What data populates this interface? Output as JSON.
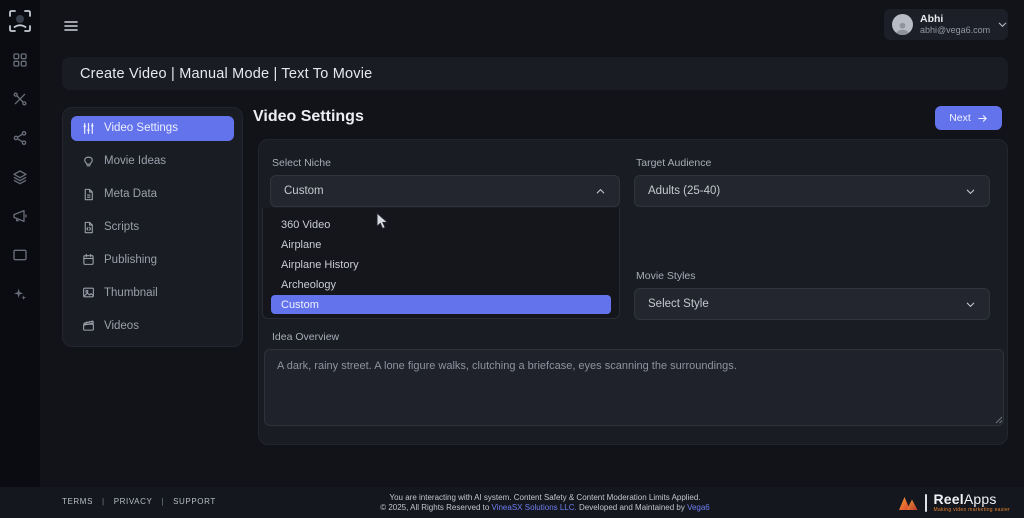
{
  "colors": {
    "accent": "#6373ec",
    "rail_bg": "#0a0c11",
    "page_bg": "#111319",
    "card_bg": "#191c23",
    "brand_orange": "#e8812b"
  },
  "topbar": {
    "user": {
      "name": "Abhi",
      "email": "abhi@vega6.com"
    }
  },
  "title_bar": {
    "text": "Create Video | Manual Mode | Text To Movie"
  },
  "sidebar": {
    "items": [
      {
        "label": "Video Settings",
        "icon": "sliders-icon",
        "active": true
      },
      {
        "label": "Movie Ideas",
        "icon": "lightbulb-icon",
        "active": false
      },
      {
        "label": "Meta Data",
        "icon": "file-icon",
        "active": false
      },
      {
        "label": "Scripts",
        "icon": "code-file-icon",
        "active": false
      },
      {
        "label": "Publishing",
        "icon": "calendar-icon",
        "active": false
      },
      {
        "label": "Thumbnail",
        "icon": "image-icon",
        "active": false
      },
      {
        "label": "Videos",
        "icon": "clapperboard-icon",
        "active": false
      }
    ]
  },
  "main": {
    "heading": "Video Settings",
    "next_label": "Next",
    "form": {
      "select_niche": {
        "label": "Select Niche",
        "value": "Custom",
        "options": [
          "360 Video",
          "Airplane",
          "Airplane History",
          "Archeology",
          "Custom"
        ],
        "highlighted_option": "Custom"
      },
      "target_audience": {
        "label": "Target Audience",
        "value": "Adults (25-40)"
      },
      "movie_styles": {
        "label": "Movie Styles",
        "value": "Select Style"
      },
      "idea_overview": {
        "label": "Idea Overview",
        "placeholder": "A dark, rainy street. A lone figure walks, clutching a briefcase, eyes scanning the surroundings."
      }
    }
  },
  "footer": {
    "links": [
      "TERMS",
      "PRIVACY",
      "SUPPORT"
    ],
    "separator": "|",
    "notice_line1": "You are interacting with AI system. Content Safety & Content Moderation Limits Applied.",
    "notice_line2_prefix": "© 2025, All Rights Reserved to ",
    "notice_link1": "VineaSX Solutions LLC.",
    "notice_mid": " Developed and Maintained by ",
    "notice_link2": "Vega6",
    "brand": {
      "name_bold": "Reel",
      "name_light": "Apps",
      "tagline": "Making video marketing easier"
    }
  }
}
